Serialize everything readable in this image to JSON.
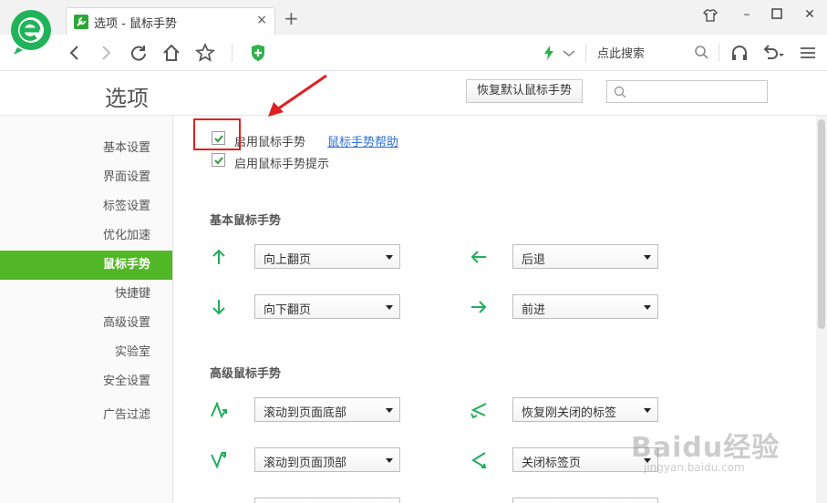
{
  "tab": {
    "title": "选项 - 鼠标手势",
    "close": "×",
    "new_tab": "+"
  },
  "window": {
    "minimize": "–",
    "close": "✕"
  },
  "toolbar": {
    "search_label": "点此搜索"
  },
  "options": {
    "title": "选项",
    "restore_button": "恢复默认鼠标手势",
    "search_placeholder": ""
  },
  "sidebar": {
    "items": [
      {
        "label": "基本设置",
        "active": false
      },
      {
        "label": "界面设置",
        "active": false
      },
      {
        "label": "标签设置",
        "active": false
      },
      {
        "label": "优化加速",
        "active": false
      },
      {
        "label": "鼠标手势",
        "active": true
      },
      {
        "label": "快捷键",
        "active": false
      },
      {
        "label": "高级设置",
        "active": false
      },
      {
        "label": "实验室",
        "active": false
      },
      {
        "label": "安全设置",
        "active": false
      },
      {
        "label": "广告过滤",
        "active": false
      }
    ]
  },
  "content": {
    "enable_gesture": {
      "label": "启用鼠标手势",
      "checked": true
    },
    "help_link": "鼠标手势帮助",
    "enable_hint": {
      "label": "启用鼠标手势提示",
      "checked": true
    },
    "basic_title": "基本鼠标手势",
    "advanced_title": "高级鼠标手势",
    "basic": [
      {
        "gesture": "up-arrow-icon",
        "action": "向上翻页"
      },
      {
        "gesture": "left-arrow-icon",
        "action": "后退"
      },
      {
        "gesture": "down-arrow-icon",
        "action": "向下翻页"
      },
      {
        "gesture": "right-arrow-icon",
        "action": "前进"
      }
    ],
    "advanced": [
      {
        "gesture": "up-down-right-gesture-icon",
        "action": "滚动到页面底部"
      },
      {
        "gesture": "left-right-gesture-icon",
        "action": "恢复刚关闭的标签"
      },
      {
        "gesture": "down-up-right-gesture-icon",
        "action": "滚动到页面顶部"
      },
      {
        "gesture": "left-down-right-gesture-icon",
        "action": "关闭标签页"
      }
    ]
  },
  "colors": {
    "accent": "#52b727",
    "gesture_arrow": "#1fae5a",
    "annotation": "#e02020"
  },
  "watermark": {
    "main": "Baidu经验",
    "sub": "jingyan.baidu.com"
  }
}
